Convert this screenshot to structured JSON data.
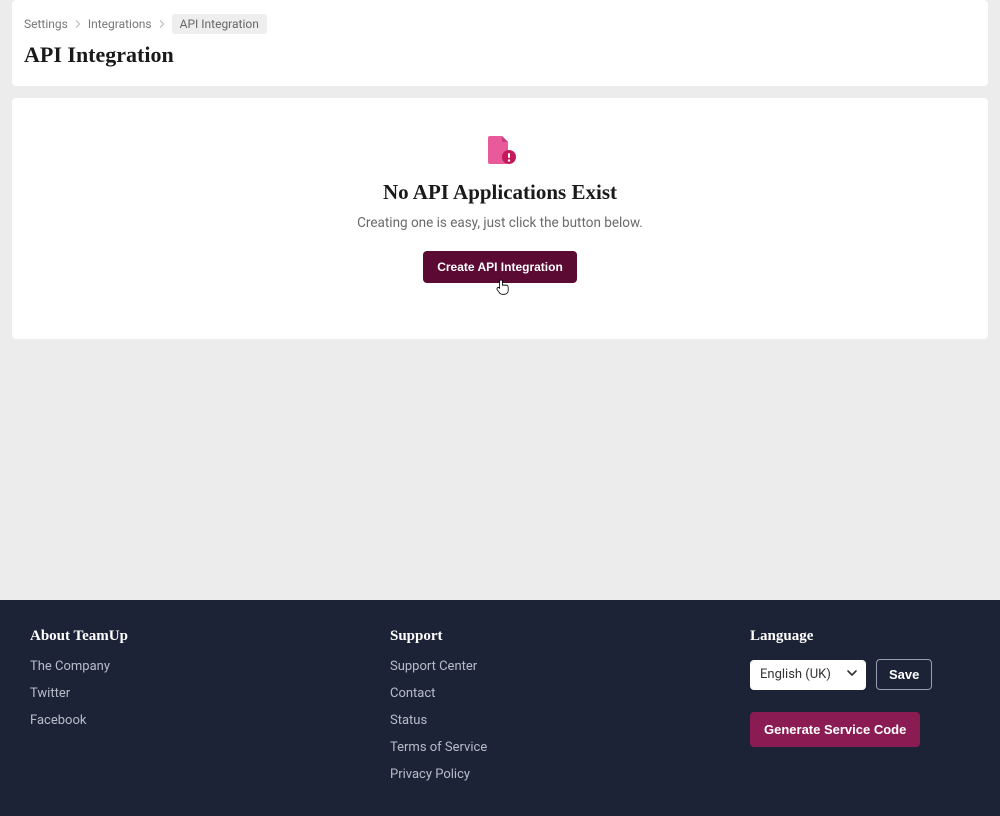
{
  "breadcrumb": {
    "items": [
      "Settings",
      "Integrations",
      "API Integration"
    ]
  },
  "page": {
    "title": "API Integration"
  },
  "empty_state": {
    "title": "No API Applications Exist",
    "subtitle": "Creating one is easy, just click the button below.",
    "button_label": "Create API Integration"
  },
  "footer": {
    "about": {
      "heading": "About TeamUp",
      "links": [
        "The Company",
        "Twitter",
        "Facebook"
      ]
    },
    "support": {
      "heading": "Support",
      "links": [
        "Support Center",
        "Contact",
        "Status",
        "Terms of Service",
        "Privacy Policy"
      ]
    },
    "language": {
      "heading": "Language",
      "selected": "English (UK)",
      "save_label": "Save",
      "generate_label": "Generate Service Code"
    }
  }
}
